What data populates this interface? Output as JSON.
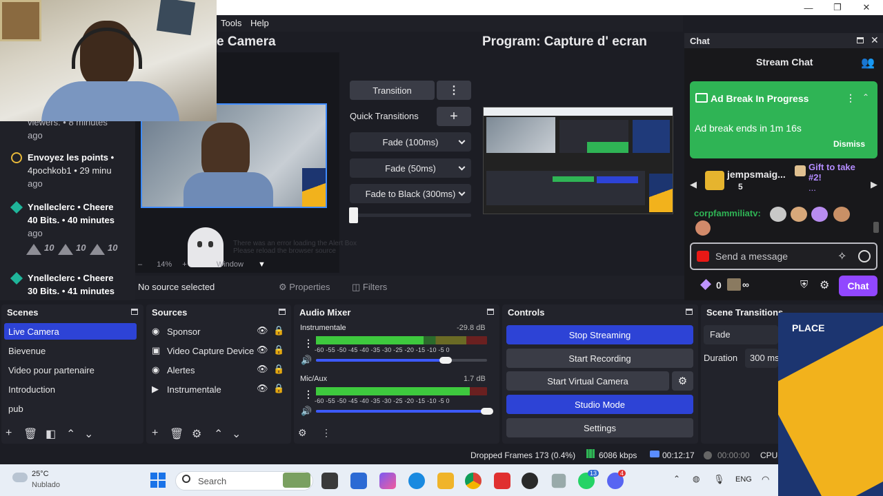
{
  "menu": {
    "tools": "Tools",
    "help": "Help"
  },
  "window_controls": {
    "minimize": "—",
    "restore": "❐",
    "close": "✕"
  },
  "preview": {
    "title": "e Camera",
    "zoom": "14%",
    "window_label": "Window",
    "browser_error_line1": "There was an error loading the Alert Box",
    "browser_error_line2": "Please reload the browser source"
  },
  "program": {
    "title": "Program: Capture d' ecran"
  },
  "transitions": {
    "transition_label": "Transition",
    "more": "⋮",
    "quick_label": "Quick Transitions",
    "add": "+",
    "items": [
      "Fade (100ms)",
      "Fade (50ms)",
      "Fade to Black (300ms)"
    ]
  },
  "events": [
    {
      "line1": "viewers. • 8 minutes",
      "line2": "ago"
    },
    {
      "line1": "Envoyez les points •",
      "line2": "4pochkob1 • 29 minu",
      "line3": "ago"
    },
    {
      "line1": "Ynelleclerc • Cheere",
      "line2": "40 Bits. • 40 minutes",
      "line3": "ago",
      "bits": [
        "10",
        "10",
        "10"
      ]
    },
    {
      "line1": "Ynelleclerc • Cheere",
      "line2": "30 Bits. • 41 minutes"
    }
  ],
  "chat": {
    "dock_title": "Chat",
    "header": "Stream Chat",
    "ad_title": "Ad Break In Progress",
    "ad_body": "Ad break ends in 1m 16s",
    "dismiss": "Dismiss",
    "gifter_name": "jempsmaig...",
    "gifter_count": "5",
    "gift_text": "Gift to take #2!",
    "gift_more": "...",
    "chatter": "corpfammiliatv:",
    "placeholder": "Send a message",
    "points": "0",
    "infinity": "∞",
    "chat_button": "Chat"
  },
  "properties_bar": {
    "no_source": "No source selected",
    "properties": "Properties",
    "filters": "Filters"
  },
  "scenes": {
    "title": "Scenes",
    "items": [
      "Live Camera",
      "Bievenue",
      "Video pour partenaire",
      "Introduction",
      "pub"
    ],
    "active": "Live Camera"
  },
  "sources": {
    "title": "Sources",
    "items": [
      "Sponsor",
      "Video Capture Device",
      "Alertes",
      "Instrumentale"
    ]
  },
  "audio_mixer": {
    "title": "Audio Mixer",
    "tracks": [
      {
        "name": "Instrumentale",
        "db": "-29.8 dB",
        "level": 0.63,
        "volume": 0.76
      },
      {
        "name": "Mic/Aux",
        "db": "1.7 dB",
        "level": 0.9,
        "volume": 1.0
      }
    ],
    "scale": "-60 -55 -50 -45 -40 -35 -30 -25 -20 -15 -10 -5 0"
  },
  "controls": {
    "title": "Controls",
    "stop_streaming": "Stop Streaming",
    "start_recording": "Start Recording",
    "start_virtual_camera": "Start Virtual Camera",
    "studio_mode": "Studio Mode",
    "settings": "Settings"
  },
  "scene_transitions": {
    "title": "Scene Transitions",
    "value": "Fade",
    "duration_label": "Duration",
    "duration": "300 ms"
  },
  "status": {
    "dropped": "Dropped Frames 173 (0.4%)",
    "bitrate": "6086 kbps",
    "stream_time": "00:12:17",
    "rec_time": "00:00:00",
    "cpu": "CPU:"
  },
  "taskbar": {
    "temp": "25°C",
    "weather": "Nublado",
    "search": "Search",
    "lang": "ENG",
    "badge_whatsapp": "13",
    "badge_discord": "4"
  },
  "overlay": {
    "place": "PLACE"
  },
  "colors": {
    "obs_blue": "#2d43d6",
    "twitch_purple": "#9147ff",
    "ad_green": "#2fb455"
  }
}
